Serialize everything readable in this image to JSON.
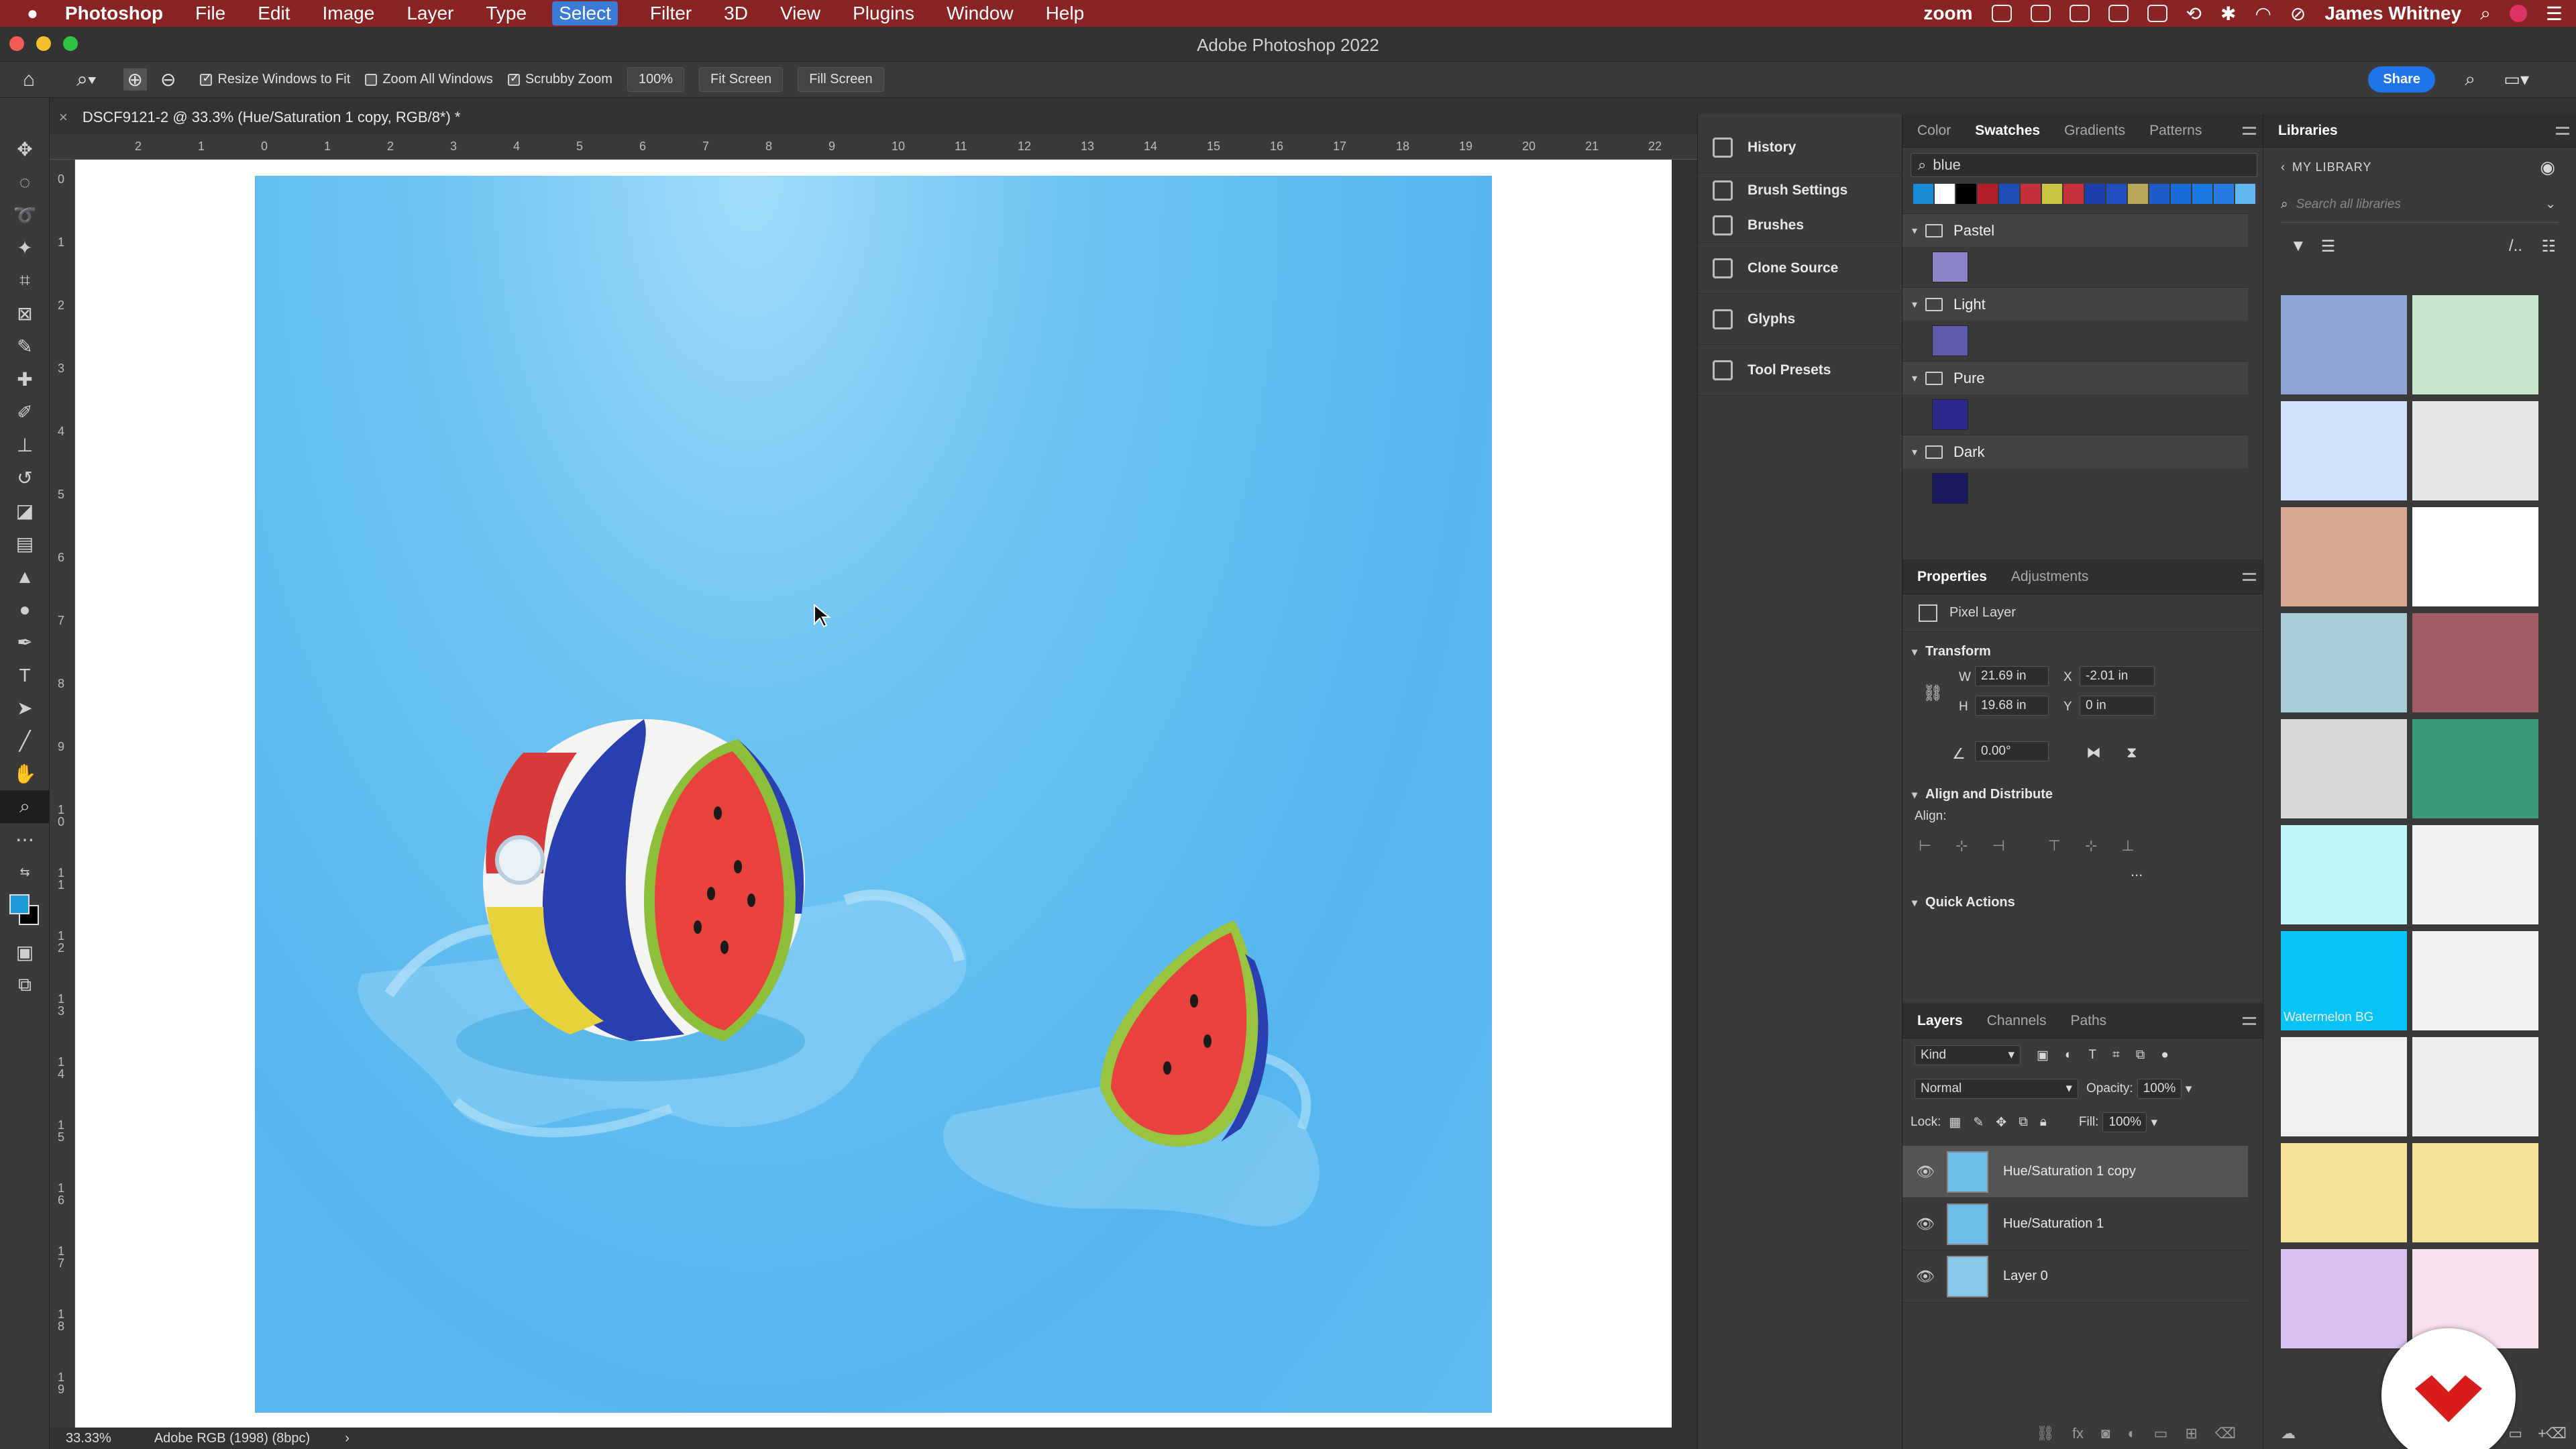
{
  "menubar": {
    "app": "Photoshop",
    "items": [
      "File",
      "Edit",
      "Image",
      "Layer",
      "Type",
      "Select",
      "Filter",
      "3D",
      "View",
      "Plugins",
      "Window",
      "Help"
    ],
    "selected": "Select",
    "zoom": "zoom",
    "user": "James Whitney"
  },
  "window": {
    "title": "Adobe Photoshop 2022"
  },
  "options": {
    "resize_windows": "Resize Windows to Fit",
    "zoom_all": "Zoom All Windows",
    "scrubby": "Scrubby Zoom",
    "percent": "100%",
    "fit_screen": "Fit Screen",
    "fill_screen": "Fill Screen",
    "share": "Share"
  },
  "document": {
    "tab": "DSCF9121-2 @ 33.3% (Hue/Saturation 1 copy, RGB/8*) *",
    "ruler_h": [
      "2",
      "1",
      "0",
      "1",
      "2",
      "3",
      "4",
      "5",
      "6",
      "7",
      "8",
      "9",
      "10",
      "11",
      "12",
      "13",
      "14",
      "15",
      "16",
      "17",
      "18",
      "19",
      "20",
      "21",
      "22"
    ],
    "ruler_v": [
      "0",
      "1",
      "2",
      "3",
      "4",
      "5",
      "6",
      "7",
      "8",
      "9",
      "1\n0",
      "1\n1",
      "1\n2",
      "1\n3",
      "1\n4",
      "1\n5",
      "1\n6",
      "1\n7",
      "1\n8",
      "1\n9"
    ]
  },
  "status": {
    "zoom": "33.33%",
    "profile": "Adobe RGB (1998) (8bpc)"
  },
  "collapsed_panels": [
    "History",
    "Brush Settings",
    "Brushes",
    "Clone Source",
    "Glyphs",
    "Tool Presets"
  ],
  "swatches": {
    "tabs": [
      "Color",
      "Swatches",
      "Gradients",
      "Patterns"
    ],
    "active_tab": "Swatches",
    "search": "blue",
    "row_colors": [
      "#1a8ad4",
      "#ffffff",
      "#000000",
      "#b3202a",
      "#1f4fb8",
      "#c4303a",
      "#c9c443",
      "#c8303b",
      "#1d3faa",
      "#2250c0",
      "#b8a85a",
      "#1f5cc8",
      "#1a6ad8",
      "#1b7ae0",
      "#2a7ae4",
      "#60b8ee"
    ],
    "groups": [
      {
        "name": "Pastel",
        "color": "#8b85c8"
      },
      {
        "name": "Light",
        "color": "#5f5aae"
      },
      {
        "name": "Pure",
        "color": "#2b2a8c"
      },
      {
        "name": "Dark",
        "color": "#1a1960"
      }
    ]
  },
  "properties": {
    "tabs": [
      "Properties",
      "Adjustments"
    ],
    "active_tab": "Properties",
    "layer_type": "Pixel Layer",
    "transform_label": "Transform",
    "w_label": "W",
    "w": "21.69 in",
    "h_label": "H",
    "h": "19.68 in",
    "x_label": "X",
    "x": "-2.01 in",
    "y_label": "Y",
    "y": "0 in",
    "angle": "0.00°",
    "align_label": "Align and Distribute",
    "align": "Align:",
    "quick_actions": "Quick Actions",
    "more": "..."
  },
  "layers": {
    "tabs": [
      "Layers",
      "Channels",
      "Paths"
    ],
    "active_tab": "Layers",
    "kind": "Kind",
    "blend": "Normal",
    "opacity_label": "Opacity:",
    "opacity": "100%",
    "lock_label": "Lock:",
    "fill_label": "Fill:",
    "fill": "100%",
    "items": [
      {
        "name": "Hue/Saturation 1 copy",
        "selected": true
      },
      {
        "name": "Hue/Saturation 1",
        "selected": false
      },
      {
        "name": "Layer 0",
        "selected": false
      }
    ]
  },
  "libraries": {
    "title": "Libraries",
    "back": "MY LIBRARY",
    "search_placeholder": "Search all libraries",
    "tiles": [
      "#8fa6d4",
      "#c8e6cc",
      "#d0e0fa",
      "#e6e6e6",
      "#d8a890",
      "#ffffff",
      "#a8cdd8",
      "#a05c62",
      "#d8d8d8",
      "#3a9a7c",
      "#c0f6f6",
      "#f2f2f2",
      "#08c4f6",
      "#f0f0f0",
      "#f0f0f0",
      "#eeeeee",
      "#f4e296",
      "#f4e296",
      "#d8c0f2",
      "#f8e0ec"
    ],
    "caption": "Watermelon BG"
  }
}
